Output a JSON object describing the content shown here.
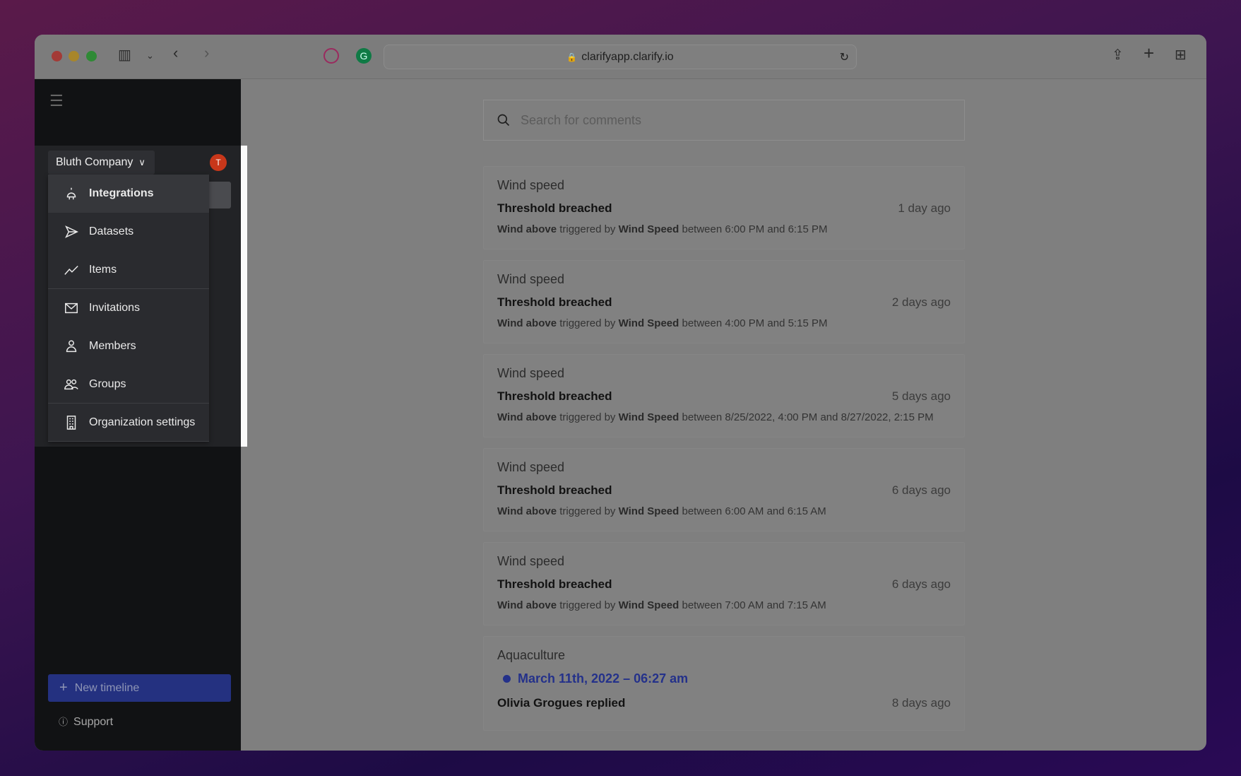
{
  "browser": {
    "url": "clarifyapp.clarify.io"
  },
  "sidebar": {
    "company": "Bluth Company",
    "avatar_initial": "T",
    "menu": [
      {
        "label": "Integrations",
        "icon": "plug-icon"
      },
      {
        "label": "Datasets",
        "icon": "send-icon"
      },
      {
        "label": "Items",
        "icon": "trend-line-icon"
      },
      {
        "label": "Invitations",
        "icon": "envelope-icon"
      },
      {
        "label": "Members",
        "icon": "person-icon"
      },
      {
        "label": "Groups",
        "icon": "group-icon"
      },
      {
        "label": "Organization settings",
        "icon": "building-icon"
      }
    ],
    "new_timeline": "New timeline",
    "support": "Support"
  },
  "search": {
    "placeholder": "Search for comments"
  },
  "cards": [
    {
      "title": "Wind speed",
      "heading": "Threshold breached",
      "time": "1 day ago",
      "rule": "Wind above",
      "mid": "triggered by",
      "source": "Wind Speed",
      "range": "between 6:00 PM and 6:15 PM"
    },
    {
      "title": "Wind speed",
      "heading": "Threshold breached",
      "time": "2 days ago",
      "rule": "Wind above",
      "mid": "triggered by",
      "source": "Wind Speed",
      "range": "between 4:00 PM and 5:15 PM"
    },
    {
      "title": "Wind speed",
      "heading": "Threshold breached",
      "time": "5 days ago",
      "rule": "Wind above",
      "mid": "triggered by",
      "source": "Wind Speed",
      "range": "between 8/25/2022, 4:00 PM and 8/27/2022, 2:15 PM"
    },
    {
      "title": "Wind speed",
      "heading": "Threshold breached",
      "time": "6 days ago",
      "rule": "Wind above",
      "mid": "triggered by",
      "source": "Wind Speed",
      "range": "between 6:00 AM and 6:15 AM"
    },
    {
      "title": "Wind speed",
      "heading": "Threshold breached",
      "time": "6 days ago",
      "rule": "Wind above",
      "mid": "triggered by",
      "source": "Wind Speed",
      "range": "between 7:00 AM and 7:15 AM"
    }
  ],
  "last_card": {
    "title": "Aquaculture",
    "date": "March 11th, 2022 – 06:27 am",
    "heading": "Olivia Grogues replied",
    "time": "8 days ago"
  }
}
